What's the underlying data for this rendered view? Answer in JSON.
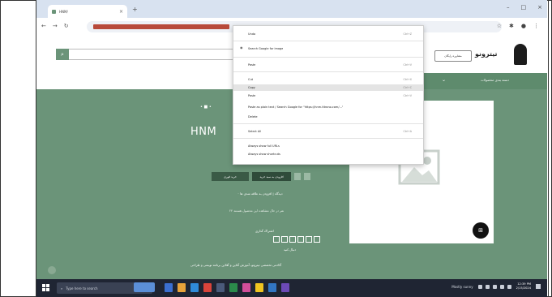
{
  "browser": {
    "tab_title": "HNM/ "
  },
  "site": {
    "logo_text": "تیترونو",
    "advice_button": "مشاوره رایگان",
    "nav_label": "دسته بندی محصولات"
  },
  "hero": {
    "title": "HNM",
    "btn_primary": "افزودن به سبد خرید",
    "btn_secondary": "خرید فوری",
    "line1": "۰ دیدگاه   |   افزودن به علاقه مندی ها",
    "line2": "۲۴ نفر در حال مشاهده این محصول هستند",
    "social_title": "اشتراک گذاری",
    "follow_title": "دنبال کنید",
    "footer_line": "آکادمی تخصصی تیترونو، آموزش آنلاین و آفلاین برنامه نویسی و طراحی"
  },
  "context_menu": {
    "items": [
      {
        "label": "Undo",
        "shortcut": "Ctrl+Z"
      },
      {
        "label": "Search Google for image",
        "shortcut": ""
      },
      {
        "label": "Paste",
        "shortcut": "Ctrl+V"
      },
      {
        "label": "Cut",
        "shortcut": "Ctrl+X"
      },
      {
        "label": "Copy",
        "shortcut": "Ctrl+C",
        "highlight": true
      },
      {
        "label": "Paste",
        "shortcut": "Ctrl+V"
      },
      {
        "label": "Paste as plain text / Search Google for \"https://hnm.titrono.com/...\"",
        "shortcut": ""
      },
      {
        "label": "Delete",
        "shortcut": ""
      },
      {
        "label": "Select All",
        "shortcut": "Ctrl+A"
      },
      {
        "label": "Always show full URLs",
        "shortcut": ""
      },
      {
        "label": "Always show shortcuts",
        "shortcut": ""
      }
    ]
  },
  "taskbar": {
    "search_placeholder": "Type here to search",
    "weather": "Mostly sunny",
    "time": "12:39 PM",
    "date": "2/15/2024"
  },
  "colors": {
    "brand_green": "#6b9479",
    "dark_green": "#24473a",
    "url_highlight": "#b84a3a",
    "taskbar": "#1f2533"
  }
}
